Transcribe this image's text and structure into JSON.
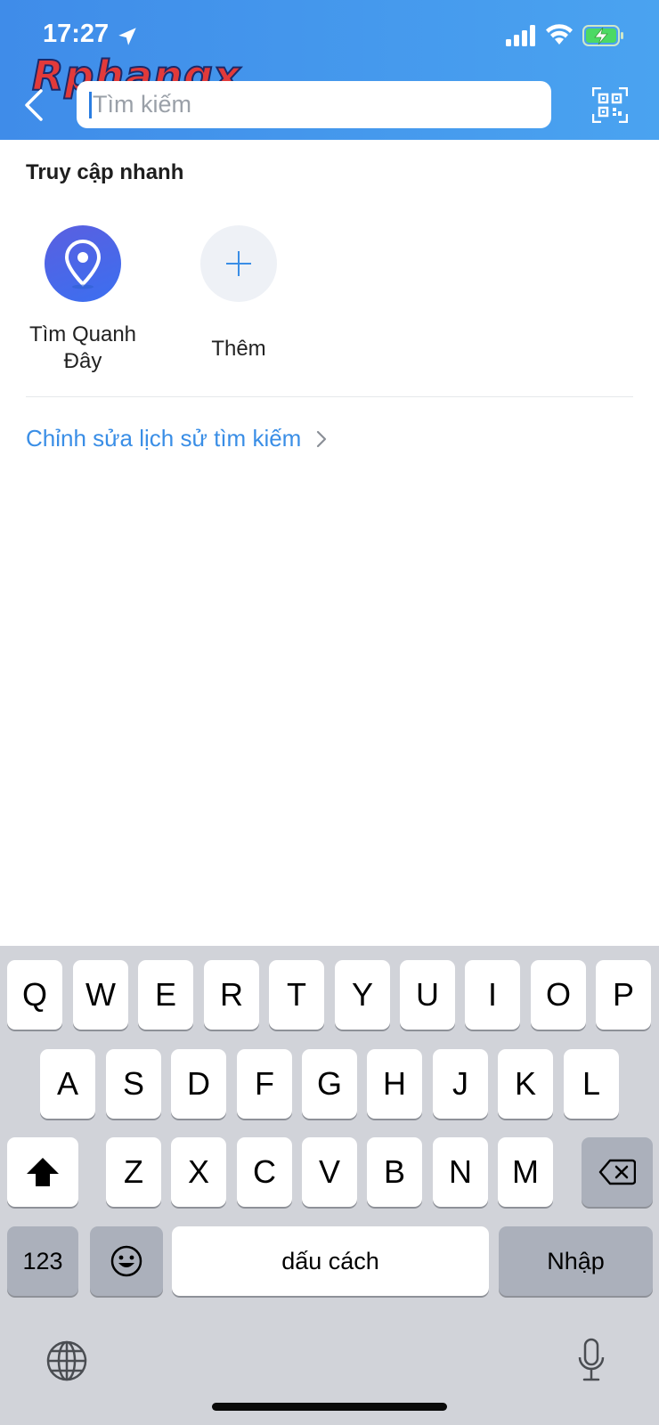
{
  "status": {
    "time": "17:27"
  },
  "watermark": {
    "text": "Rphangx"
  },
  "search": {
    "placeholder": "Tìm kiếm",
    "value": ""
  },
  "quick_access": {
    "title": "Truy cập nhanh",
    "items": [
      {
        "label_line1": "Tìm Quanh",
        "label_line2": "Đây",
        "icon": "location-pin-icon"
      },
      {
        "label": "Thêm",
        "icon": "plus-icon"
      }
    ]
  },
  "edit_history_link": "Chỉnh sửa lịch sử tìm kiếm",
  "keyboard": {
    "row1": [
      "Q",
      "W",
      "E",
      "R",
      "T",
      "Y",
      "U",
      "I",
      "O",
      "P"
    ],
    "row2": [
      "A",
      "S",
      "D",
      "F",
      "G",
      "H",
      "J",
      "K",
      "L"
    ],
    "row3": [
      "Z",
      "X",
      "C",
      "V",
      "B",
      "N",
      "M"
    ],
    "numbers_key": "123",
    "space_key": "dấu cách",
    "return_key": "Nhập"
  },
  "colors": {
    "header": "#4096ea",
    "link": "#3a8ee6",
    "keyboard_bg": "#d1d3d9"
  }
}
